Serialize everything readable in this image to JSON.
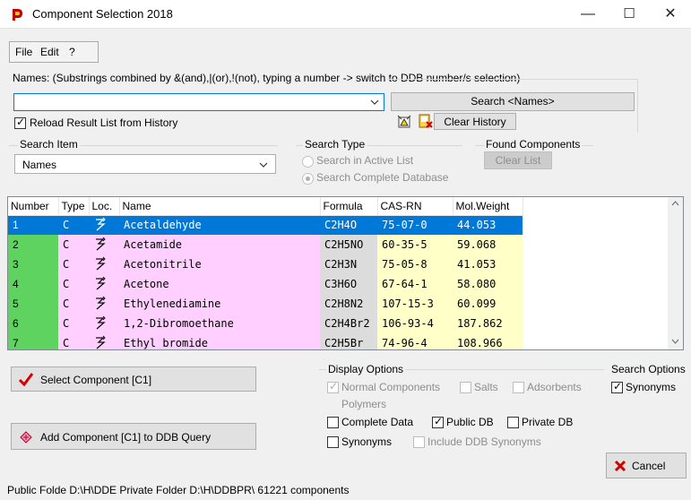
{
  "window": {
    "title": "Component Selection 2018",
    "minimize": "—",
    "maximize": "☐",
    "close": "✕"
  },
  "menu": {
    "file": "File",
    "edit": "Edit",
    "help": "?"
  },
  "names": {
    "label": "Names: (Substrings combined by &(and),|(or),!(not), typing a number -> switch to DDB number/s selection)",
    "input_value": "",
    "search_button": "Search <Names>",
    "reload_label": "Reload Result List from History",
    "reload_checked": true,
    "clear_history": "Clear History"
  },
  "search_item": {
    "label": "Search Item",
    "selected": "Names"
  },
  "search_type": {
    "label": "Search Type",
    "active_list": "Search in  Active List",
    "complete_db": "Search Complete Database"
  },
  "found": {
    "label": "Found Components",
    "clear_list": "Clear List"
  },
  "table": {
    "headers": [
      "Number",
      "Type",
      "Loc.",
      "Name",
      "Formula",
      "CAS-RN",
      "Mol.Weight"
    ],
    "rows": [
      {
        "num": "1",
        "type": "C",
        "name": "Acetaldehyde",
        "formula": "C2H4O",
        "cas": "75-07-0",
        "mw": "44.053"
      },
      {
        "num": "2",
        "type": "C",
        "name": "Acetamide",
        "formula": "C2H5NO",
        "cas": "60-35-5",
        "mw": "59.068"
      },
      {
        "num": "3",
        "type": "C",
        "name": "Acetonitrile",
        "formula": "C2H3N",
        "cas": "75-05-8",
        "mw": "41.053"
      },
      {
        "num": "4",
        "type": "C",
        "name": "Acetone",
        "formula": "C3H6O",
        "cas": "67-64-1",
        "mw": "58.080"
      },
      {
        "num": "5",
        "type": "C",
        "name": "Ethylenediamine",
        "formula": "C2H8N2",
        "cas": "107-15-3",
        "mw": "60.099"
      },
      {
        "num": "6",
        "type": "C",
        "name": "1,2-Dibromoethane",
        "formula": "C2H4Br2",
        "cas": "106-93-4",
        "mw": "187.862"
      },
      {
        "num": "7",
        "type": "C",
        "name": "Ethyl bromide",
        "formula": "C2H5Br",
        "cas": "74-96-4",
        "mw": "108.966"
      }
    ]
  },
  "actions": {
    "select": "Select Component [C1]",
    "add": "Add Component [C1] to DDB Query",
    "cancel": "Cancel"
  },
  "display_options": {
    "label": "Display Options",
    "normal": "Normal Components",
    "salts": "Salts",
    "adsorbents": "Adsorbents",
    "polymers": "Polymers",
    "complete_data": "Complete Data",
    "public_db": "Public DB",
    "private_db": "Private DB",
    "synonyms": "Synonyms",
    "include_ddb_synonyms": "Include DDB Synonyms"
  },
  "search_options": {
    "label": "Search Options",
    "synonyms": "Synonyms"
  },
  "status": {
    "text": "Public Folde  D:\\H\\DDE  Private Folder  D:\\H\\DDBPR\\  61221 components"
  },
  "colors": {
    "selection": "#0078d7",
    "number_cell": "#5fd35f",
    "name_cell": "#ffd0ff",
    "check_red": "#d40000"
  }
}
